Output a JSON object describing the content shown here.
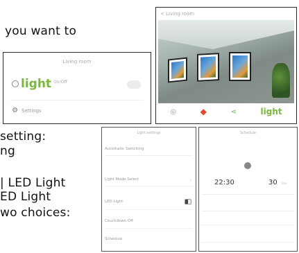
{
  "document": {
    "lines": [
      "you want to",
      "setting:",
      "ng",
      "| LED Light",
      "ED Light",
      "wo choices:"
    ]
  },
  "living_room_card": {
    "title": "Living room",
    "light_label": "light",
    "onoff_label": "On/Off",
    "settings_label": "Settings"
  },
  "camera_panel": {
    "header": "< Living room",
    "bottom_light_label": "light"
  },
  "settings_panel": {
    "title": "Light settings",
    "rows": [
      "Automatic Switching",
      "Light Mode Select",
      "LED Light",
      "Countdown Off",
      "Schedule"
    ]
  },
  "schedule_panel": {
    "title": "Schedule",
    "time_on": "22:30",
    "time_off": "30",
    "time_off_unit": "min"
  },
  "colors": {
    "accent_green": "#7ab83a",
    "alert_red": "#e04a2c"
  }
}
